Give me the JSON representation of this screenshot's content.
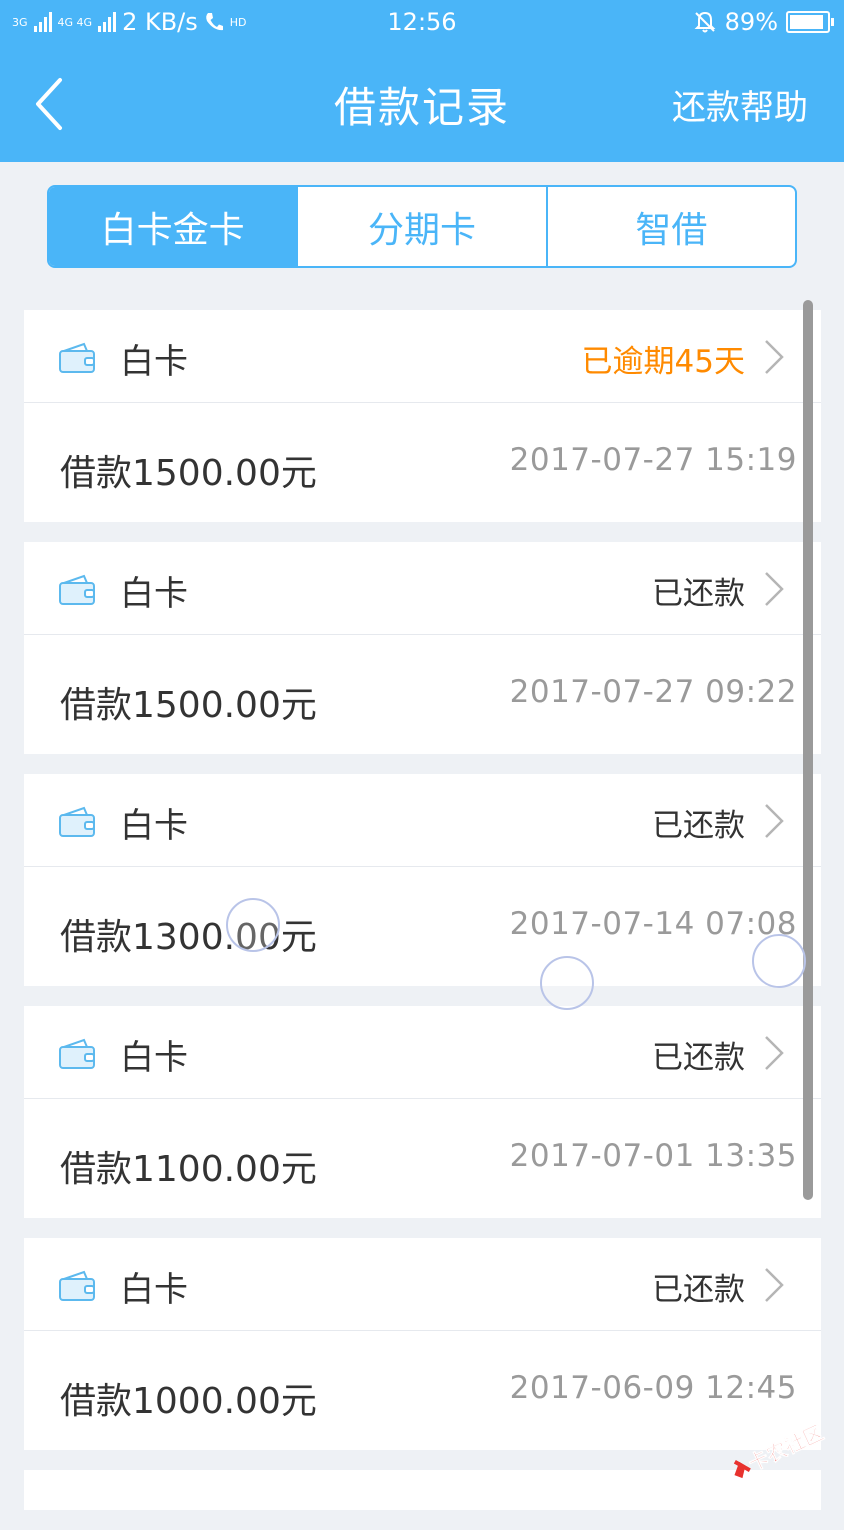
{
  "status_bar": {
    "network_left": "3G",
    "network_mid": "4G 4G",
    "speed": "2 KB/s",
    "hd": "HD",
    "time": "12:56",
    "battery": "89%"
  },
  "nav": {
    "title": "借款记录",
    "help": "还款帮助"
  },
  "tabs": [
    {
      "label": "白卡金卡",
      "active": true
    },
    {
      "label": "分期卡",
      "active": false
    },
    {
      "label": "智借",
      "active": false
    }
  ],
  "records": [
    {
      "type": "白卡",
      "status": "已逾期45天",
      "amount": "借款1500.00元",
      "date": "2017-07-27 15:19"
    },
    {
      "type": "白卡",
      "status": "已还款",
      "amount": "借款1500.00元",
      "date": "2017-07-27 09:22"
    },
    {
      "type": "白卡",
      "status": "已还款",
      "amount": "借款1300.00元",
      "date": "2017-07-14 07:08"
    },
    {
      "type": "白卡",
      "status": "已还款",
      "amount": "借款1100.00元",
      "date": "2017-07-01 13:35"
    },
    {
      "type": "白卡",
      "status": "已还款",
      "amount": "借款1000.00元",
      "date": "2017-06-09 12:45"
    }
  ],
  "watermark": "卡农社区",
  "colors": {
    "brand": "#4ab5f8",
    "overdue": "#ff8a00",
    "background": "#eef1f5"
  }
}
